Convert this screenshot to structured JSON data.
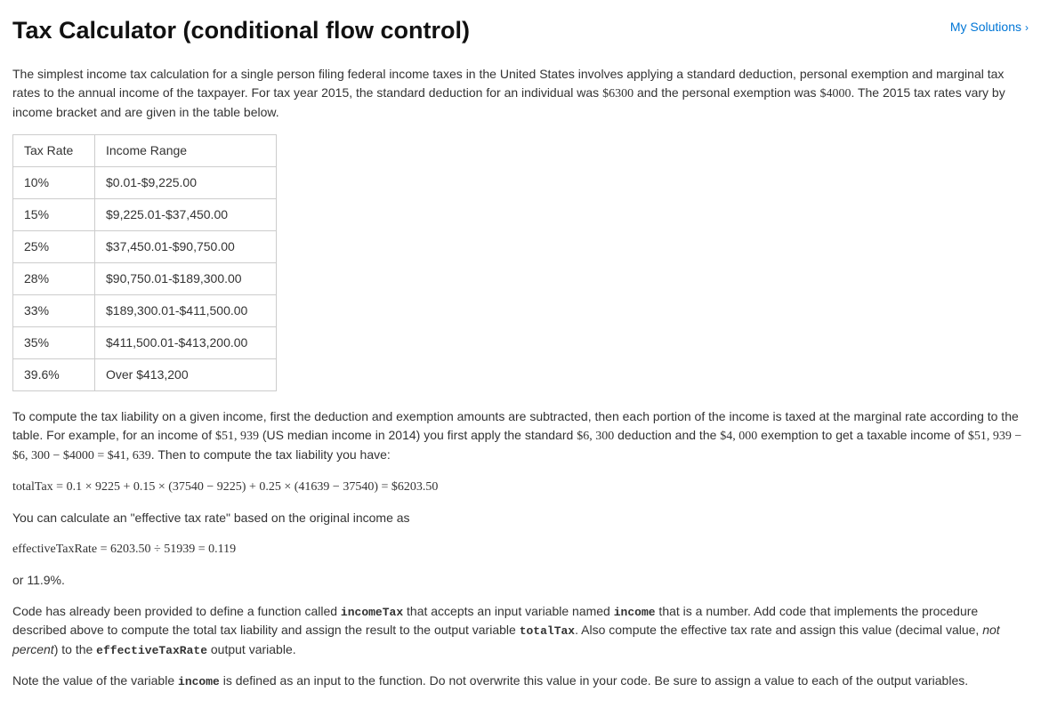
{
  "header": {
    "title": "Tax Calculator (conditional flow control)",
    "solutions_link": "My Solutions"
  },
  "intro": {
    "pre": "The simplest income tax calculation for a single person filing federal income taxes in the United States involves applying a standard deduction, personal exemption and marginal tax rates to the annual income of the taxpayer. For tax year 2015, the standard deduction for an individual was ",
    "dedn": "$6300",
    "mid": " and the personal exemption was ",
    "exem": "$4000",
    "post": ". The 2015 tax rates vary by income bracket and are given in the table below."
  },
  "table": {
    "head_rate": "Tax Rate",
    "head_range": "Income Range",
    "rows": [
      {
        "rate": "10%",
        "range": "$0.01-$9,225.00"
      },
      {
        "rate": "15%",
        "range": "$9,225.01-$37,450.00"
      },
      {
        "rate": "25%",
        "range": "$37,450.01-$90,750.00"
      },
      {
        "rate": "28%",
        "range": "$90,750.01-$189,300.00"
      },
      {
        "rate": "33%",
        "range": "$189,300.01-$411,500.00"
      },
      {
        "rate": "35%",
        "range": "$411,500.01-$413,200.00"
      },
      {
        "rate": "39.6%",
        "range": "Over $413,200"
      }
    ]
  },
  "example": {
    "p1a": "To compute the tax liability on a given income, first the deduction and exemption amounts are subtracted, then each portion of the income is taxed at the marginal rate according to the table. For example, for an income of ",
    "income": "$51, 939",
    "p1b": " (US median income in 2014) you first apply the standard ",
    "dedn": "$6, 300",
    "p1c": " deduction and the ",
    "exem": "$4, 000",
    "p1d": " exemption to get a taxable income of ",
    "subtraction": "$51, 939 − $6, 300 − $4000 = $41, 639",
    "p1e": ". Then to compute the tax liability you have:",
    "eq1": "totalTax = 0.1 × 9225 + 0.15 × (37540 − 9225) + 0.25 × (41639 − 37540) = $6203.50",
    "p2": "You can calculate an \"effective tax rate\" based on the original income as",
    "eq2": "effectiveTaxRate = 6203.50 ÷ 51939 = 0.119",
    "p3": "or 11.9%."
  },
  "instructions": {
    "p1_a": "Code has already been provided to define a function called ",
    "fn": "incomeTax",
    "p1_b": " that accepts an input variable named ",
    "inp": "income",
    "p1_c": " that is a number. Add code that implements the procedure described above to compute the total tax liability and assign the result to the output variable ",
    "out1": "totalTax",
    "p1_d": ".  Also compute the effective tax rate and assign this value (decimal value, ",
    "ital": "not percent",
    "p1_e": ") to the ",
    "out2": "effectiveTaxRate",
    "p1_f": " output variable.",
    "p2_a": "Note the value of the variable ",
    "var": "income",
    "p2_b": " is defined as an input to the function.  Do not overwrite this value in your code.  Be sure to assign a value to each of the output variables."
  }
}
